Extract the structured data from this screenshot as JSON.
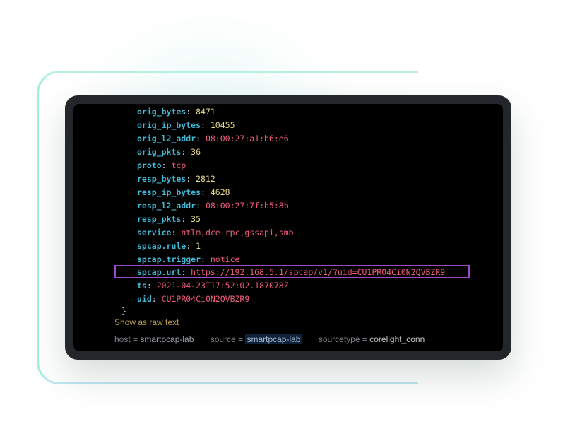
{
  "fields": [
    {
      "key": "orig_bytes",
      "value": "8471",
      "kind": "num"
    },
    {
      "key": "orig_ip_bytes",
      "value": "10455",
      "kind": "num"
    },
    {
      "key": "orig_l2_addr",
      "value": "08:00:27:a1:b6:e6",
      "kind": "str"
    },
    {
      "key": "orig_pkts",
      "value": "36",
      "kind": "num"
    },
    {
      "key": "proto",
      "value": "tcp",
      "kind": "str"
    },
    {
      "key": "resp_bytes",
      "value": "2812",
      "kind": "num"
    },
    {
      "key": "resp_ip_bytes",
      "value": "4628",
      "kind": "num"
    },
    {
      "key": "resp_l2_addr",
      "value": "08:00:27:7f:b5:8b",
      "kind": "str"
    },
    {
      "key": "resp_pkts",
      "value": "35",
      "kind": "num"
    },
    {
      "key": "service",
      "value": "ntlm,dce_rpc,gssapi,smb",
      "kind": "str"
    },
    {
      "key": "spcap.rule",
      "value": "1",
      "kind": "num"
    },
    {
      "key": "spcap.trigger",
      "value": "notice",
      "kind": "str"
    },
    {
      "key": "spcap.url",
      "value": "https://192.168.5.1/spcap/v1/?uid=CU1PR04Ci0N2QVBZR9",
      "kind": "str"
    },
    {
      "key": "ts",
      "value": "2021-04-23T17:52:02.187078Z",
      "kind": "str"
    },
    {
      "key": "uid",
      "value": "CU1PR04Ci0N2QVBZR9",
      "kind": "str"
    }
  ],
  "separator": ": ",
  "closing_brace": "}",
  "raw_link_label": "Show as raw text",
  "meta": {
    "host_label": "host =",
    "host_value": "smartpcap-lab",
    "source_label": "source =",
    "source_value": "smartpcap-lab",
    "sourcetype_label": "sourcetype =",
    "sourcetype_value": "corelight_conn"
  },
  "colors": {
    "key": "#41b8d6",
    "number": "#e2d88a",
    "string": "#ef5d7d",
    "highlight_box": "#9a4ac2",
    "raw_link": "#b79a52"
  }
}
